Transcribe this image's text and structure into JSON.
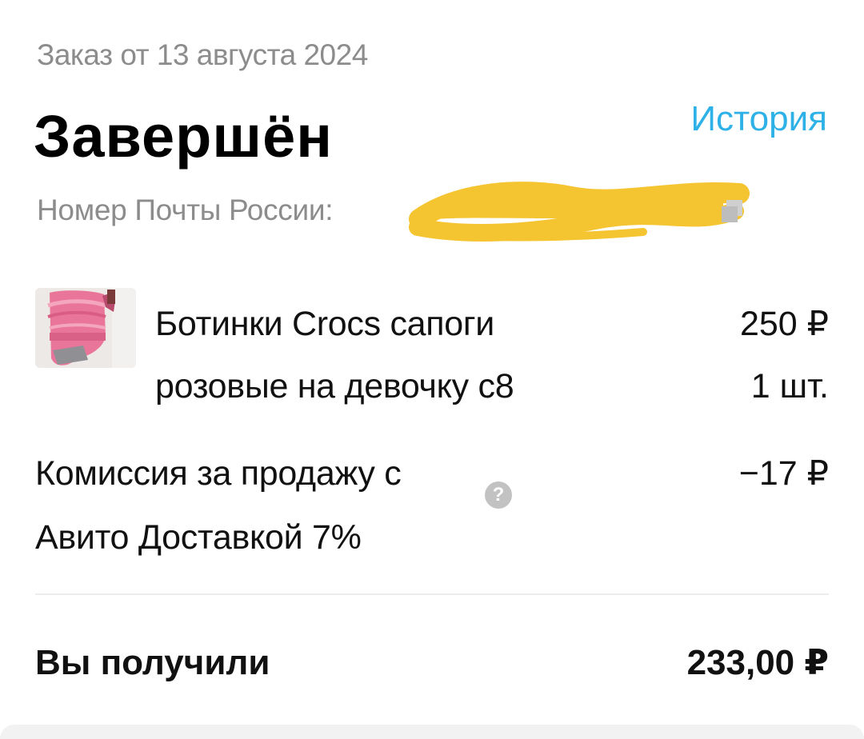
{
  "order": {
    "date_text": "Заказ от 13 августа 2024",
    "status": "Завершён",
    "history_link": "История",
    "tracking_label": "Номер Почты России:",
    "tracking_redacted": true
  },
  "product": {
    "name": "Ботинки Crocs сапоги розовые на девочку с8",
    "price": "250 ₽",
    "quantity": "1 шт."
  },
  "commission": {
    "label": "Комиссия за продажу с Авито Доставкой 7%",
    "value": "−17 ₽",
    "help_icon": "?"
  },
  "total": {
    "label": "Вы получили",
    "value": "233,00 ₽"
  },
  "colors": {
    "accent_link": "#2eb1e6",
    "muted_text": "#8c8c8c",
    "redaction": "#f5c431",
    "divider": "#ececec"
  },
  "icons": {
    "copy": "copy-icon",
    "help": "question-icon"
  }
}
